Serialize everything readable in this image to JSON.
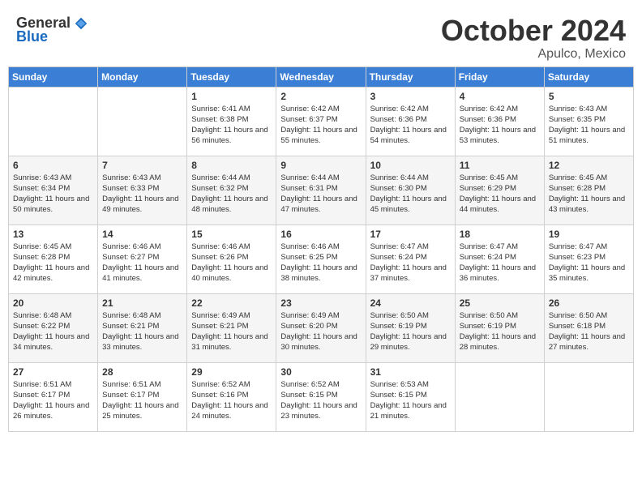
{
  "header": {
    "logo_general": "General",
    "logo_blue": "Blue",
    "month": "October 2024",
    "location": "Apulco, Mexico"
  },
  "weekdays": [
    "Sunday",
    "Monday",
    "Tuesday",
    "Wednesday",
    "Thursday",
    "Friday",
    "Saturday"
  ],
  "weeks": [
    [
      {
        "day": "",
        "info": ""
      },
      {
        "day": "",
        "info": ""
      },
      {
        "day": "1",
        "info": "Sunrise: 6:41 AM\nSunset: 6:38 PM\nDaylight: 11 hours and 56 minutes."
      },
      {
        "day": "2",
        "info": "Sunrise: 6:42 AM\nSunset: 6:37 PM\nDaylight: 11 hours and 55 minutes."
      },
      {
        "day": "3",
        "info": "Sunrise: 6:42 AM\nSunset: 6:36 PM\nDaylight: 11 hours and 54 minutes."
      },
      {
        "day": "4",
        "info": "Sunrise: 6:42 AM\nSunset: 6:36 PM\nDaylight: 11 hours and 53 minutes."
      },
      {
        "day": "5",
        "info": "Sunrise: 6:43 AM\nSunset: 6:35 PM\nDaylight: 11 hours and 51 minutes."
      }
    ],
    [
      {
        "day": "6",
        "info": "Sunrise: 6:43 AM\nSunset: 6:34 PM\nDaylight: 11 hours and 50 minutes."
      },
      {
        "day": "7",
        "info": "Sunrise: 6:43 AM\nSunset: 6:33 PM\nDaylight: 11 hours and 49 minutes."
      },
      {
        "day": "8",
        "info": "Sunrise: 6:44 AM\nSunset: 6:32 PM\nDaylight: 11 hours and 48 minutes."
      },
      {
        "day": "9",
        "info": "Sunrise: 6:44 AM\nSunset: 6:31 PM\nDaylight: 11 hours and 47 minutes."
      },
      {
        "day": "10",
        "info": "Sunrise: 6:44 AM\nSunset: 6:30 PM\nDaylight: 11 hours and 45 minutes."
      },
      {
        "day": "11",
        "info": "Sunrise: 6:45 AM\nSunset: 6:29 PM\nDaylight: 11 hours and 44 minutes."
      },
      {
        "day": "12",
        "info": "Sunrise: 6:45 AM\nSunset: 6:28 PM\nDaylight: 11 hours and 43 minutes."
      }
    ],
    [
      {
        "day": "13",
        "info": "Sunrise: 6:45 AM\nSunset: 6:28 PM\nDaylight: 11 hours and 42 minutes."
      },
      {
        "day": "14",
        "info": "Sunrise: 6:46 AM\nSunset: 6:27 PM\nDaylight: 11 hours and 41 minutes."
      },
      {
        "day": "15",
        "info": "Sunrise: 6:46 AM\nSunset: 6:26 PM\nDaylight: 11 hours and 40 minutes."
      },
      {
        "day": "16",
        "info": "Sunrise: 6:46 AM\nSunset: 6:25 PM\nDaylight: 11 hours and 38 minutes."
      },
      {
        "day": "17",
        "info": "Sunrise: 6:47 AM\nSunset: 6:24 PM\nDaylight: 11 hours and 37 minutes."
      },
      {
        "day": "18",
        "info": "Sunrise: 6:47 AM\nSunset: 6:24 PM\nDaylight: 11 hours and 36 minutes."
      },
      {
        "day": "19",
        "info": "Sunrise: 6:47 AM\nSunset: 6:23 PM\nDaylight: 11 hours and 35 minutes."
      }
    ],
    [
      {
        "day": "20",
        "info": "Sunrise: 6:48 AM\nSunset: 6:22 PM\nDaylight: 11 hours and 34 minutes."
      },
      {
        "day": "21",
        "info": "Sunrise: 6:48 AM\nSunset: 6:21 PM\nDaylight: 11 hours and 33 minutes."
      },
      {
        "day": "22",
        "info": "Sunrise: 6:49 AM\nSunset: 6:21 PM\nDaylight: 11 hours and 31 minutes."
      },
      {
        "day": "23",
        "info": "Sunrise: 6:49 AM\nSunset: 6:20 PM\nDaylight: 11 hours and 30 minutes."
      },
      {
        "day": "24",
        "info": "Sunrise: 6:50 AM\nSunset: 6:19 PM\nDaylight: 11 hours and 29 minutes."
      },
      {
        "day": "25",
        "info": "Sunrise: 6:50 AM\nSunset: 6:19 PM\nDaylight: 11 hours and 28 minutes."
      },
      {
        "day": "26",
        "info": "Sunrise: 6:50 AM\nSunset: 6:18 PM\nDaylight: 11 hours and 27 minutes."
      }
    ],
    [
      {
        "day": "27",
        "info": "Sunrise: 6:51 AM\nSunset: 6:17 PM\nDaylight: 11 hours and 26 minutes."
      },
      {
        "day": "28",
        "info": "Sunrise: 6:51 AM\nSunset: 6:17 PM\nDaylight: 11 hours and 25 minutes."
      },
      {
        "day": "29",
        "info": "Sunrise: 6:52 AM\nSunset: 6:16 PM\nDaylight: 11 hours and 24 minutes."
      },
      {
        "day": "30",
        "info": "Sunrise: 6:52 AM\nSunset: 6:15 PM\nDaylight: 11 hours and 23 minutes."
      },
      {
        "day": "31",
        "info": "Sunrise: 6:53 AM\nSunset: 6:15 PM\nDaylight: 11 hours and 21 minutes."
      },
      {
        "day": "",
        "info": ""
      },
      {
        "day": "",
        "info": ""
      }
    ]
  ]
}
